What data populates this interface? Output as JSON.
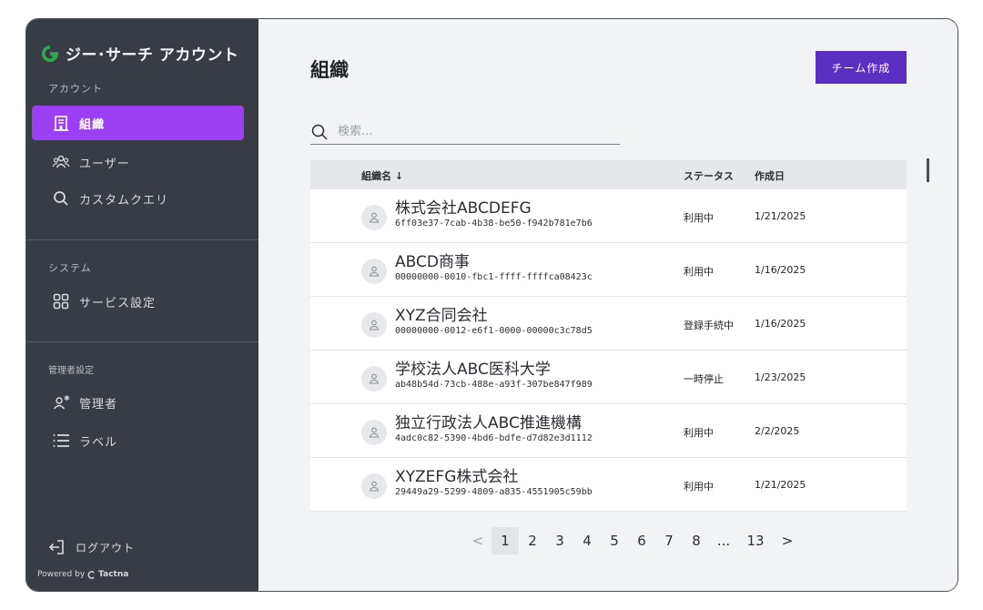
{
  "app": {
    "brand_title": "ジー･サーチ アカウント",
    "brand_color": "#2fa84f"
  },
  "sidebar": {
    "section_account": "アカウント",
    "section_system": "システム",
    "section_admin": "管理者設定",
    "items": [
      {
        "label": "組織",
        "icon": "building-icon",
        "active": true
      },
      {
        "label": "ユーザー",
        "icon": "users-icon",
        "active": false
      },
      {
        "label": "カスタムクエリ",
        "icon": "search-icon",
        "active": false
      },
      {
        "label": "サービス設定",
        "icon": "grid-icon",
        "active": false
      },
      {
        "label": "管理者",
        "icon": "admin-icon",
        "active": false
      },
      {
        "label": "ラベル",
        "icon": "list-icon",
        "active": false
      }
    ],
    "logout_label": "ログアウト",
    "powered_prefix": "Powered by",
    "powered_brand": "Tactna",
    "active_color": "#9c3ff2"
  },
  "main": {
    "title": "組織",
    "create_button": "チーム作成",
    "search_placeholder": "検索...",
    "columns": {
      "name": "組織名 ↓",
      "status": "ステータス",
      "created": "作成日"
    },
    "rows": [
      {
        "name": "株式会社ABCDEFG",
        "id": "6ff03e37-7cab-4b38-be50-f942b781e7b6",
        "status": "利用中",
        "created": "1/21/2025"
      },
      {
        "name": "ABCD商事",
        "id": "00000000-0010-fbc1-ffff-ffffca08423c",
        "status": "利用中",
        "created": "1/16/2025"
      },
      {
        "name": "XYZ合同会社",
        "id": "00000000-0012-e6f1-0000-00000c3c78d5",
        "status": "登録手続中",
        "created": "1/16/2025"
      },
      {
        "name": "学校法人ABC医科大学",
        "id": "ab48b54d-73cb-488e-a93f-307be847f989",
        "status": "一時停止",
        "created": "1/23/2025"
      },
      {
        "name": "独立行政法人ABC推進機構",
        "id": "4adc0c82-5390-4bd6-bdfe-d7d82e3d1112",
        "status": "利用中",
        "created": "2/2/2025"
      },
      {
        "name": "XYZEFG株式会社",
        "id": "29449a29-5299-4809-a835-4551905c59bb",
        "status": "利用中",
        "created": "1/21/2025"
      }
    ],
    "pagination": {
      "prev": "<",
      "pages": [
        "1",
        "2",
        "3",
        "4",
        "5",
        "6",
        "7",
        "8",
        "...",
        "13"
      ],
      "current": "1",
      "next": ">"
    },
    "button_color": "#5a2fc2"
  }
}
